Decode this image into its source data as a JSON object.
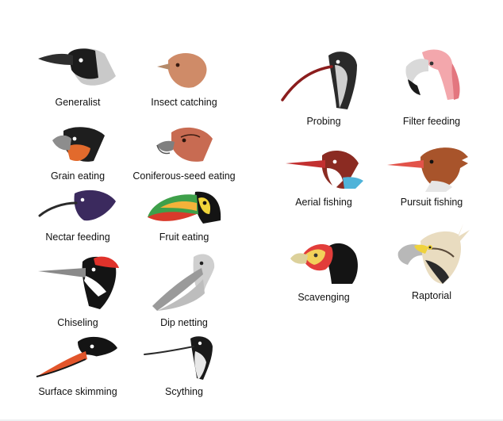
{
  "title": "",
  "beaks": [
    {
      "id": "generalist",
      "label": "Generalist"
    },
    {
      "id": "insect",
      "label": "Insect catching"
    },
    {
      "id": "grain",
      "label": "Grain eating"
    },
    {
      "id": "conifer",
      "label": "Coniferous-seed eating"
    },
    {
      "id": "nectar",
      "label": "Nectar feeding"
    },
    {
      "id": "fruit",
      "label": "Fruit eating"
    },
    {
      "id": "chisel",
      "label": "Chiseling"
    },
    {
      "id": "dipnet",
      "label": "Dip netting"
    },
    {
      "id": "skim",
      "label": "Surface skimming"
    },
    {
      "id": "scythe",
      "label": "Scything"
    },
    {
      "id": "probe",
      "label": "Probing"
    },
    {
      "id": "filter",
      "label": "Filter feeding"
    },
    {
      "id": "aerial",
      "label": "Aerial fishing"
    },
    {
      "id": "pursuit",
      "label": "Pursuit fishing"
    },
    {
      "id": "scav",
      "label": "Scavenging"
    },
    {
      "id": "raptor",
      "label": "Raptorial"
    }
  ],
  "icons": {
    "generalist": "crow-head-icon",
    "insect": "flycatcher-head-icon",
    "grain": "finch-head-icon",
    "conifer": "crossbill-head-icon",
    "nectar": "hummingbird-head-icon",
    "fruit": "toucan-head-icon",
    "chisel": "woodpecker-head-icon",
    "dipnet": "pelican-head-icon",
    "skim": "skimmer-head-icon",
    "scythe": "avocet-head-icon",
    "probe": "ibis-head-icon",
    "filter": "flamingo-head-icon",
    "aerial": "kingfisher-head-icon",
    "pursuit": "merganser-head-icon",
    "scav": "vulture-head-icon",
    "raptor": "eagle-head-icon"
  }
}
